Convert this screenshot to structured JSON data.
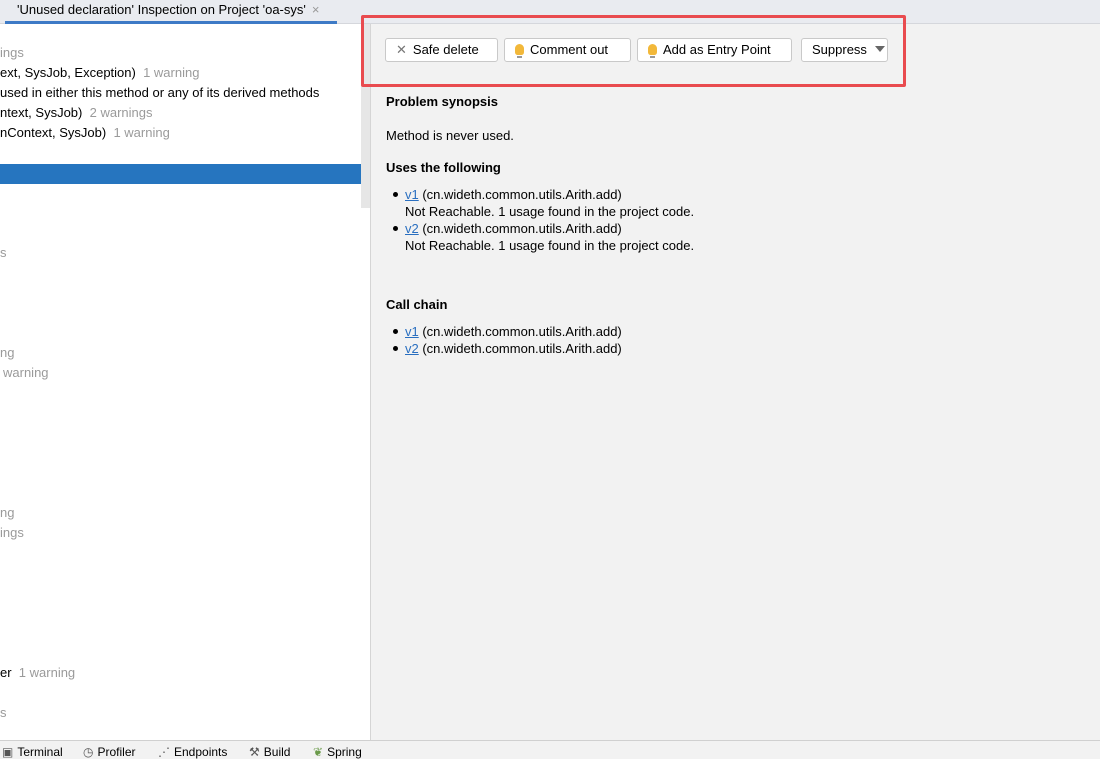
{
  "tab": {
    "title": "'Unused declaration' Inspection on Project 'oa-sys'",
    "close": "×"
  },
  "tree": [
    {
      "text": "",
      "count": "ings"
    },
    {
      "text": "ext, SysJob, Exception)",
      "count": "1 warning"
    },
    {
      "text": "used in either this method or any of its derived methods",
      "count": ""
    },
    {
      "text": "ntext, SysJob)",
      "count": "2 warnings"
    },
    {
      "text": "nContext, SysJob)",
      "count": "1 warning"
    },
    {
      "text": "",
      "count": "s"
    },
    {
      "text": "",
      "count": "ng"
    },
    {
      "text": "",
      "count": "warning"
    },
    {
      "text": "",
      "count": "ng"
    },
    {
      "text": "",
      "count": "ings"
    },
    {
      "text": "er",
      "count": "1 warning"
    },
    {
      "text": "",
      "count": "s"
    }
  ],
  "toolbar": {
    "safe_delete": "Safe delete",
    "comment_out": "Comment out",
    "entry_point": "Add as Entry Point",
    "suppress": "Suppress"
  },
  "detail": {
    "synopsis_title": "Problem synopsis",
    "synopsis": "Method is never used.",
    "uses_title": "Uses the following",
    "uses": [
      {
        "link": "v1",
        "ref": " (cn.wideth.common.utils.Arith.add)",
        "note": "Not Reachable. 1 usage found in the project code."
      },
      {
        "link": "v2",
        "ref": " (cn.wideth.common.utils.Arith.add)",
        "note": "Not Reachable. 1 usage found in the project code."
      }
    ],
    "chain_title": "Call chain",
    "chain": [
      {
        "link": "v1",
        "ref": " (cn.wideth.common.utils.Arith.add)"
      },
      {
        "link": "v2",
        "ref": " (cn.wideth.common.utils.Arith.add)"
      }
    ]
  },
  "bottom": [
    "Terminal",
    "Profiler",
    "Endpoints",
    "Build",
    "Spring"
  ],
  "colors": {
    "selection": "#2675bf",
    "highlight_box": "#e94b4f",
    "link": "#2a6fc0",
    "bulb": "#f2b83a"
  }
}
